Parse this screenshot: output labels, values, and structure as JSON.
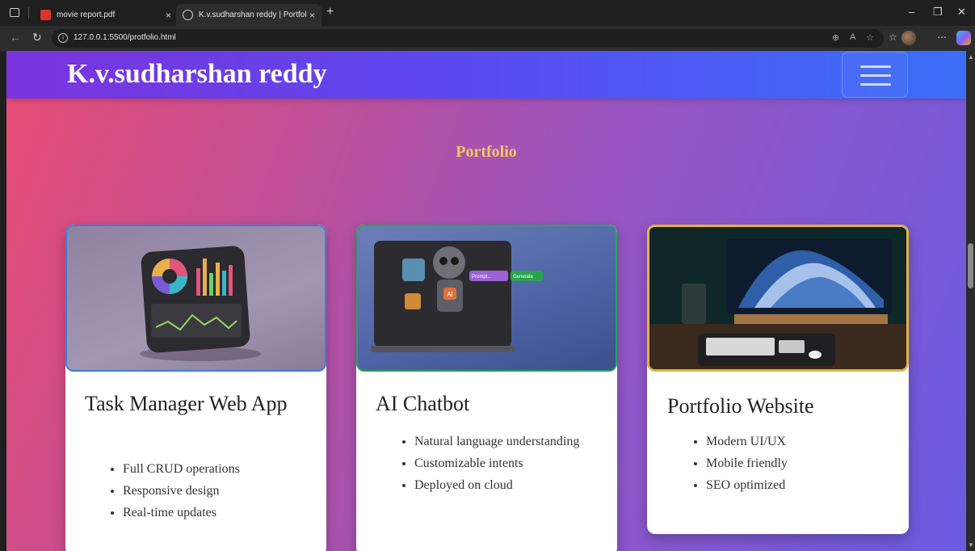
{
  "browser": {
    "tabs": [
      {
        "title": "movie report.pdf",
        "icon": "pdf-icon",
        "active": false
      },
      {
        "title": "K.v.sudharshan reddy | Portfolio",
        "icon": "globe-icon",
        "active": true
      }
    ],
    "url": "127.0.0.1:5500/protfolio.html"
  },
  "site": {
    "brand": "K.v.sudharshan reddy",
    "section_title": "Portfolio"
  },
  "projects": [
    {
      "title": "Task Manager Web App",
      "features": [
        "Full CRUD operations",
        "Responsive design",
        "Real-time updates"
      ],
      "image": "dashboard-illustration",
      "border_color": "#3f7de0"
    },
    {
      "title": "AI Chatbot",
      "features": [
        "Natural language understanding",
        "Customizable intents",
        "Deployed on cloud"
      ],
      "image": "robot-laptop-illustration",
      "image_labels": {
        "prompt": "Prompt...",
        "generate": "Generate",
        "badge": "AI"
      },
      "border_color": "#27a35a"
    },
    {
      "title": "Portfolio Website",
      "features": [
        "Modern UI/UX",
        "Mobile friendly",
        "SEO optimized"
      ],
      "image": "desk-setup-photo",
      "border_color": "#e3b43f"
    }
  ],
  "colors": {
    "header_start": "#7b33dd",
    "header_end": "#3b6ff8",
    "section_title": "#f6c85f"
  }
}
